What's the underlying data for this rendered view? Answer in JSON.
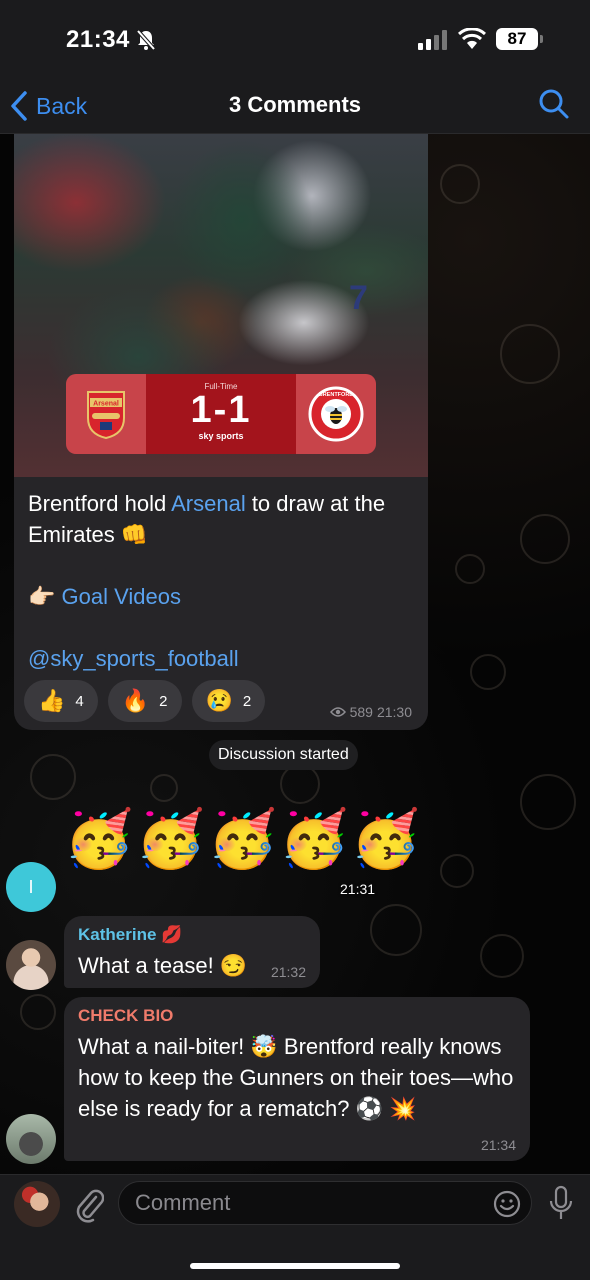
{
  "status_bar": {
    "time": "21:34",
    "battery": "87"
  },
  "nav": {
    "back_label": "Back",
    "title": "3 Comments"
  },
  "post": {
    "image": {
      "fulltime_label": "Full-Time",
      "score": "1-1",
      "broadcaster": "sky sports",
      "player_number": "7",
      "home_crest": "Arsenal",
      "away_crest": "BRENTFORD"
    },
    "text_before_link": "Brentford hold ",
    "link_arsenal": "Arsenal",
    "text_after_link": " to draw at the Emirates 👊",
    "goal_prefix": "👉🏻 ",
    "goal_videos_link": "Goal Videos",
    "channel_handle": "@sky_sports_football",
    "reactions": [
      {
        "emoji": "👍",
        "count": "4"
      },
      {
        "emoji": "🔥",
        "count": "2"
      },
      {
        "emoji": "😢",
        "count": "2"
      }
    ],
    "views": "589",
    "time": "21:30"
  },
  "service_message": "Discussion started",
  "comments": [
    {
      "avatar_letter": "I",
      "sticker": "🥳🥳🥳🥳🥳",
      "time": "21:31"
    },
    {
      "name": "Katherine 💋",
      "name_color": "#5ec2e6",
      "text": "What a tease! 😏",
      "time": "21:32"
    },
    {
      "name": "CHECK BIO",
      "name_color": "#f07b6b",
      "text": "What a nail-biter! 🤯 Brentford really knows how to keep the Gunners on their toes—who else is ready for a rematch? ⚽ 💥",
      "time": "21:34"
    }
  ],
  "composer": {
    "placeholder": "Comment"
  },
  "colors": {
    "accent": "#3d8ef0",
    "link": "#5aa2ee",
    "bubble": "#262528"
  }
}
